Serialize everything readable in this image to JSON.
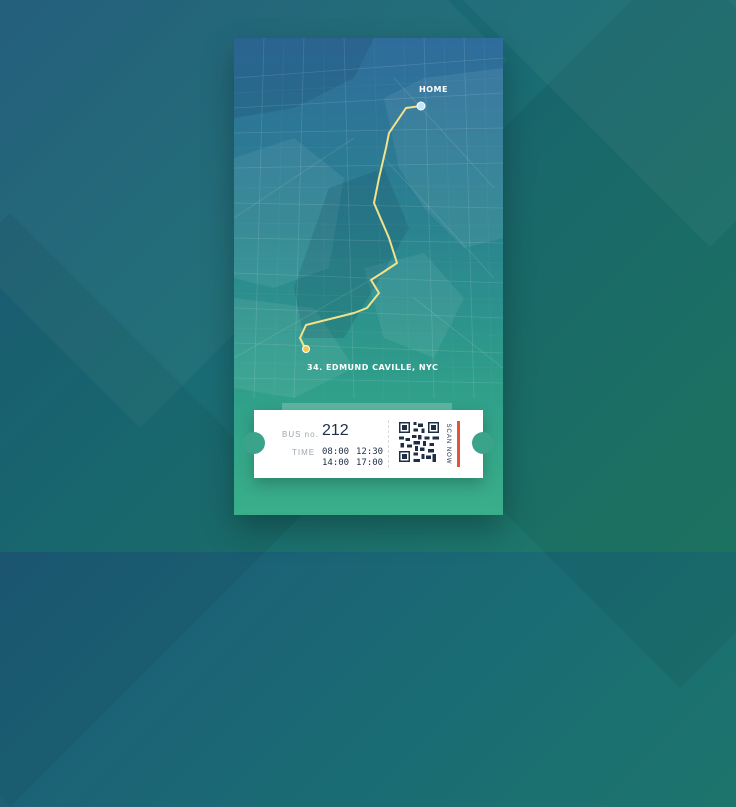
{
  "map": {
    "home_label": "HOME",
    "destination_label": "34. EDMUND CAVILLE, NYC",
    "route_color": "#f2e28a",
    "home_pin_color": "#bfe6ff",
    "destination_pin_color": "#f2c94c"
  },
  "ticket": {
    "bus_label": "BUS no.",
    "bus_number": "212",
    "time_label": "TIME",
    "departures": [
      "08:00",
      "14:00"
    ],
    "arrivals": [
      "12:30",
      "17:00"
    ],
    "scan_label": "SCAN NOW",
    "accent_color": "#e5533d"
  },
  "colors": {
    "background_start": "#1d5a78",
    "background_end": "#1e7a66",
    "ticket_text": "#1e2f45"
  }
}
